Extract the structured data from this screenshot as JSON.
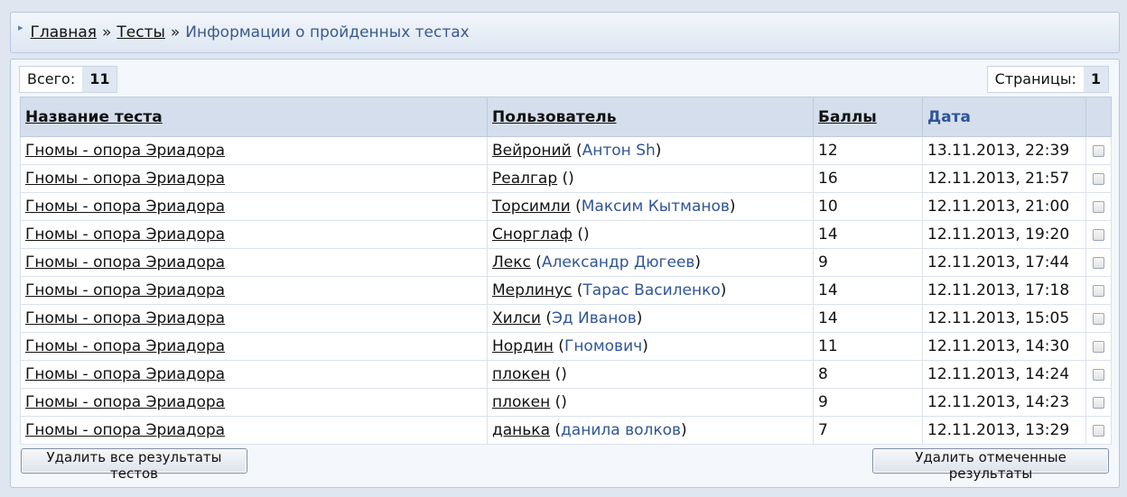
{
  "breadcrumb": {
    "home": "Главная",
    "sep1": "»",
    "tests": "Тесты",
    "sep2": "»",
    "current": "Информации о пройденных тестах"
  },
  "summary": {
    "total_label": "Всего:",
    "total_value": "11",
    "pages_label": "Страницы:",
    "pages_value": "1"
  },
  "table": {
    "headers": {
      "test": "Название теста",
      "user": "Пользователь",
      "score": "Баллы",
      "date": "Дата"
    },
    "rows": [
      {
        "test": "Гномы - опора Эриадора",
        "login": "Вейроний",
        "name": "Антон Sh",
        "score": "12",
        "date": "13.11.2013, 22:39"
      },
      {
        "test": "Гномы - опора Эриадора",
        "login": "Реалгар",
        "name": "",
        "score": "16",
        "date": "12.11.2013, 21:57"
      },
      {
        "test": "Гномы - опора Эриадора",
        "login": "Торсимли",
        "name": "Максим Кытманов",
        "score": "10",
        "date": "12.11.2013, 21:00"
      },
      {
        "test": "Гномы - опора Эриадора",
        "login": "Снорглаф",
        "name": "",
        "score": "14",
        "date": "12.11.2013, 19:20"
      },
      {
        "test": "Гномы - опора Эриадора",
        "login": "Лекс",
        "name": "Александр Дюгеев",
        "score": "9",
        "date": "12.11.2013, 17:44"
      },
      {
        "test": "Гномы - опора Эриадора",
        "login": "Мерлинус",
        "name": "Тарас Василенко",
        "score": "14",
        "date": "12.11.2013, 17:18"
      },
      {
        "test": "Гномы - опора Эриадора",
        "login": "Хилси",
        "name": "Эд Иванов",
        "score": "14",
        "date": "12.11.2013, 15:05"
      },
      {
        "test": "Гномы - опора Эриадора",
        "login": "Нордин",
        "name": "Гномович",
        "score": "11",
        "date": "12.11.2013, 14:30"
      },
      {
        "test": "Гномы - опора Эриадора",
        "login": "плокен",
        "name": "",
        "score": "8",
        "date": "12.11.2013, 14:24"
      },
      {
        "test": "Гномы - опора Эриадора",
        "login": "плокен",
        "name": "",
        "score": "9",
        "date": "12.11.2013, 14:23"
      },
      {
        "test": "Гномы - опора Эриадора",
        "login": "данька",
        "name": "данила волков",
        "score": "7",
        "date": "12.11.2013, 13:29"
      }
    ]
  },
  "buttons": {
    "delete_all": "Удалить все результаты тестов",
    "delete_selected": "Удалить отмеченные результаты"
  }
}
